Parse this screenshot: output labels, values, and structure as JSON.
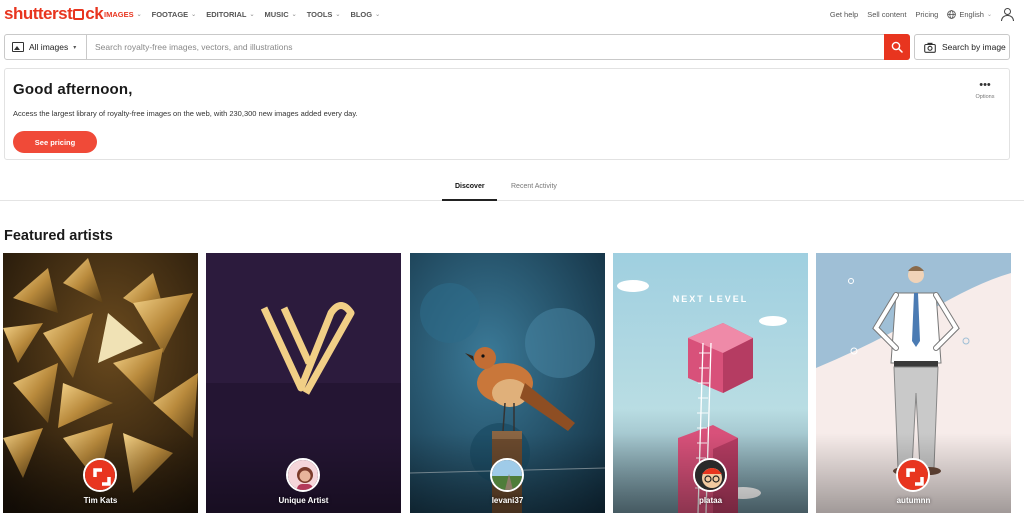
{
  "brand": {
    "name": "shutterstock",
    "color": "#e8351f"
  },
  "nav": {
    "items": [
      {
        "label": "IMAGES",
        "active": true
      },
      {
        "label": "FOOTAGE",
        "active": false
      },
      {
        "label": "EDITORIAL",
        "active": false
      },
      {
        "label": "MUSIC",
        "active": false
      },
      {
        "label": "TOOLS",
        "active": false
      },
      {
        "label": "BLOG",
        "active": false
      }
    ],
    "right": {
      "help": "Get help",
      "sell": "Sell content",
      "pricing": "Pricing",
      "language": "English"
    }
  },
  "search": {
    "filter_label": "All images",
    "placeholder": "Search royalty-free images, vectors, and illustrations",
    "value": "",
    "image_search_label": "Search by image"
  },
  "greeting": {
    "title": "Good afternoon,",
    "subtitle": "Access the largest library of royalty-free images on the web, with 230,300 new images added every day.",
    "button": "See pricing",
    "options_label": "Options"
  },
  "tabs": [
    {
      "label": "Discover",
      "active": true
    },
    {
      "label": "Recent Activity",
      "active": false
    }
  ],
  "featured": {
    "title": "Featured artists",
    "artists": [
      {
        "name": "Tim Kats"
      },
      {
        "name": "Unique Artist"
      },
      {
        "name": "levani37"
      },
      {
        "name": "plataa",
        "image_text": "NEXT LEVEL"
      },
      {
        "name": "autumnn"
      }
    ]
  }
}
